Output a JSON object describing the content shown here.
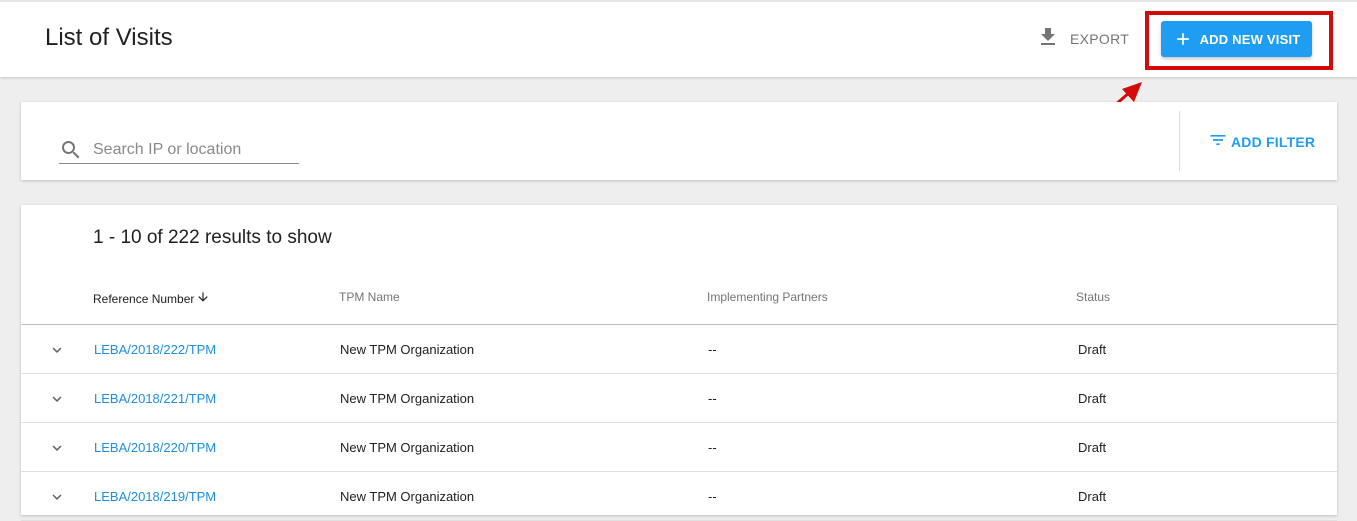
{
  "header": {
    "title": "List of Visits",
    "export_label": "EXPORT",
    "add_visit_label": "ADD NEW VISIT"
  },
  "filter": {
    "search_placeholder": "Search IP or location",
    "add_filter_label": "ADD FILTER"
  },
  "table": {
    "results_text": "1 - 10 of 222 results to show",
    "columns": {
      "reference": "Reference Number",
      "tpm": "TPM Name",
      "partners": "Implementing Partners",
      "status": "Status"
    },
    "rows": [
      {
        "reference": "LEBA/2018/222/TPM",
        "tpm": "New TPM Organization",
        "partners": "--",
        "status": "Draft"
      },
      {
        "reference": "LEBA/2018/221/TPM",
        "tpm": "New TPM Organization",
        "partners": "--",
        "status": "Draft"
      },
      {
        "reference": "LEBA/2018/220/TPM",
        "tpm": "New TPM Organization",
        "partners": "--",
        "status": "Draft"
      },
      {
        "reference": "LEBA/2018/219/TPM",
        "tpm": "New TPM Organization",
        "partners": "--",
        "status": "Draft"
      }
    ]
  },
  "icons": {
    "export": "download-icon",
    "add": "plus-icon",
    "search": "search-icon",
    "filter": "filter-list-icon",
    "sort": "arrow-down-icon",
    "row_expand": "chevron-down-icon"
  },
  "colors": {
    "primary": "#1e9df3",
    "link": "#1e8ee0",
    "highlight": "#d20c0c"
  }
}
